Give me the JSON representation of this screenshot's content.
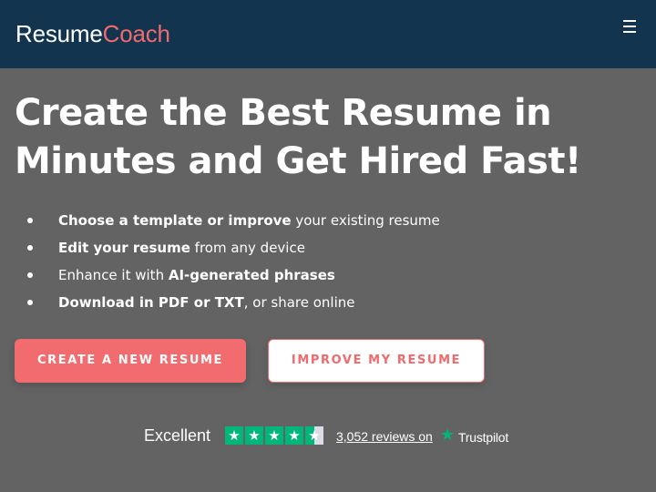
{
  "header": {
    "logo_part1": "Resume",
    "logo_part2": "Coach",
    "menu_icon": "hamburger-menu-icon"
  },
  "hero": {
    "title_line1": "Create the Best Resume in",
    "title_line2": "Minutes and Get Hired Fast!"
  },
  "features": [
    {
      "bold": "Choose a template or improve",
      "rest": " your existing resume"
    },
    {
      "bold": "Edit your resume",
      "rest": " from any device"
    },
    {
      "pre": "Enhance it with ",
      "bold": "AI-generated phrases"
    },
    {
      "bold": "Download in PDF or TXT",
      "rest": ", or share online"
    }
  ],
  "buttons": {
    "create_label": "CREATE A NEW RESUME",
    "improve_label": "IMPROVE MY RESUME"
  },
  "rating": {
    "label": "Excellent",
    "stars_value": 4.5,
    "stars_max": 5,
    "reviews_text": "3,052 reviews on",
    "provider": "Trustpilot"
  },
  "colors": {
    "header_bg": "#12344f",
    "page_bg": "#636363",
    "accent": "#f26b6e",
    "trustpilot_green": "#00b67a"
  }
}
